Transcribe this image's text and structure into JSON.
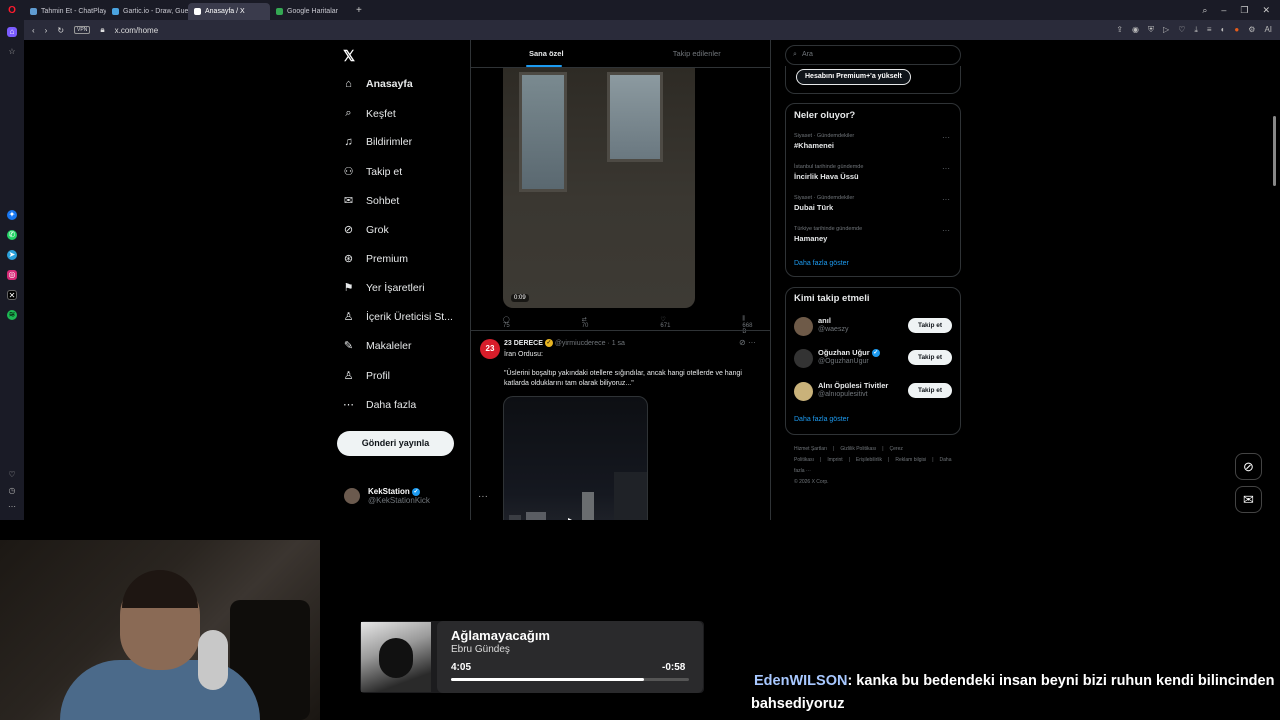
{
  "browser": {
    "tabs": [
      {
        "label": "Tahmin Et - ChatPlay",
        "color": "#5f9bd1",
        "active": false
      },
      {
        "label": "Gartic.io - Draw, Guess, W",
        "color": "#4aa3df",
        "active": false
      },
      {
        "label": "Anasayfa / X",
        "color": "#ffffff",
        "active": true
      },
      {
        "label": "Google Haritalar",
        "color": "#34a853",
        "active": false
      }
    ],
    "new_tab": "+",
    "url": "x.com/home",
    "vpn_label": "VPN",
    "ai_label": "AI"
  },
  "x": {
    "logo": "𝕏",
    "nav": [
      {
        "label": "Anasayfa",
        "icon": "home-icon",
        "glyph": "⌂",
        "bold": true
      },
      {
        "label": "Keşfet",
        "icon": "search-icon",
        "glyph": "⌕",
        "bold": false
      },
      {
        "label": "Bildirimler",
        "icon": "bell-icon",
        "glyph": "♫",
        "bold": false
      },
      {
        "label": "Takip et",
        "icon": "follow-icon",
        "glyph": "⚇",
        "bold": false
      },
      {
        "label": "Sohbet",
        "icon": "mail-icon",
        "glyph": "✉",
        "bold": false
      },
      {
        "label": "Grok",
        "icon": "grok-icon",
        "glyph": "⊘",
        "bold": false
      },
      {
        "label": "Premium",
        "icon": "premium-icon",
        "glyph": "⊛",
        "bold": false
      },
      {
        "label": "Yer İşaretleri",
        "icon": "bookmark-icon",
        "glyph": "⚑",
        "bold": false
      },
      {
        "label": "İçerik Üreticisi St...",
        "icon": "creator-icon",
        "glyph": "♙",
        "bold": false
      },
      {
        "label": "Makaleler",
        "icon": "articles-icon",
        "glyph": "✎",
        "bold": false
      },
      {
        "label": "Profil",
        "icon": "profile-icon",
        "glyph": "♙",
        "bold": false
      },
      {
        "label": "Daha fazla",
        "icon": "more-icon",
        "glyph": "⋯",
        "bold": false
      }
    ],
    "post_button": "Gönderi yayınla",
    "account": {
      "name": "KekStation",
      "handle": "@KekStationKick"
    },
    "feed_tabs": [
      "Sana özel",
      "Takip edilenler"
    ],
    "tweet1": {
      "video_time": "0:09",
      "replies": "75",
      "reposts": "70",
      "likes": "671",
      "views": "668 B"
    },
    "tweet2": {
      "name": "23 DERECE",
      "avatar_text": "23",
      "handle": "@yirmiucderece · 1 sa",
      "body": "İran Ordusu:",
      "quote": "\"Üslerini boşaltıp yakındaki otellere sığındılar, ancak hangi otellerde ve hangi katlarda olduklarını tam olarak biliyoruz...\""
    },
    "search_placeholder": "Ara",
    "premium_upgrade": "Hesabını Premium+'a yükselt",
    "trends_title": "Neler oluyor?",
    "trends": [
      {
        "meta": "Siyaset · Gündemdekiler",
        "name": "#Khamenei"
      },
      {
        "meta": "İstanbul tarihinde gündemde",
        "name": "İncirlik Hava Üssü"
      },
      {
        "meta": "Siyaset · Gündemdekiler",
        "name": "Dubai Türk"
      },
      {
        "meta": "Türkiye tarihinde gündemde",
        "name": "Hamaney"
      }
    ],
    "show_more": "Daha fazla göster",
    "who_title": "Kimi takip etmeli",
    "who": [
      {
        "name": "anıl",
        "handle": "@waeszy",
        "color": "#6e5a48",
        "verified": false
      },
      {
        "name": "Oğuzhan Uğur",
        "handle": "@OguzhanUgur",
        "color": "#333333",
        "verified": true
      },
      {
        "name": "Alnı Öpülesi Tivitler",
        "handle": "@alnıopulesitivt",
        "color": "#c9b27a",
        "verified": false
      }
    ],
    "follow_label": "Takip et",
    "footer": [
      "Hizmet Şartları",
      "|",
      "Gizlilik Politikası",
      "|",
      "Çerez Politikası",
      "|",
      "Imprint",
      "|",
      "Erişilebilirlik",
      "|",
      "Reklam bilgisi",
      "|",
      "Daha fazla ···",
      "© 2026 X Corp."
    ]
  },
  "music": {
    "title": "Ağlamayacağım",
    "artist": "Ebru Gündeş",
    "elapsed": "4:05",
    "remaining": "-0:58",
    "progress": 0.81
  },
  "chat": {
    "user": "EdenWILSON",
    "message": ": kanka bu bedendeki insan beyni bizi ruhun kendi bilincinden",
    "message2": "bahsediyoruz"
  }
}
